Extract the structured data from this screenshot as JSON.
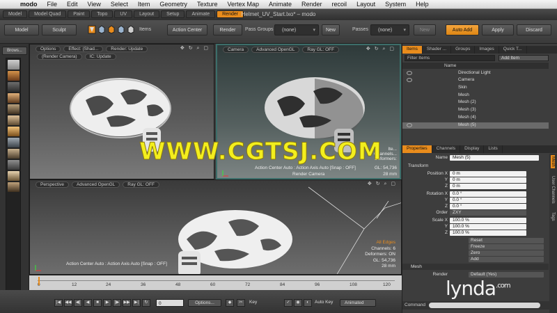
{
  "menubar": {
    "app": "modo",
    "items": [
      "File",
      "Edit",
      "View",
      "Select",
      "Item",
      "Geometry",
      "Texture",
      "Vertex Map",
      "Animate",
      "Render",
      "recoil",
      "Layout",
      "System",
      "Help"
    ]
  },
  "window": {
    "title": "Helmet_UV_Start.lxo* – modo",
    "layout_tabs": [
      "Model",
      "Model Quad",
      "Paint",
      "Topo",
      "UV",
      "Layout",
      "Setup",
      "Animate",
      "Render"
    ],
    "active_tab": "Render"
  },
  "toolbar": {
    "model": "Model",
    "sculpt": "Sculpt",
    "items": "Items",
    "action_center": "Action Center",
    "render": "Render",
    "pass_groups_label": "Pass Groups",
    "pass_groups_value": "(none)",
    "new": "New",
    "passes_label": "Passes",
    "passes_value": "(none)",
    "new2": "New",
    "auto_add": "Auto Add",
    "apply": "Apply",
    "discard": "Discard"
  },
  "sidebar": {
    "browse": "Brows..."
  },
  "viewports": {
    "topleft": {
      "chips": [
        "Options",
        "Effect: (Shad...",
        "Render: Update"
      ],
      "chips2": [
        "(Render Camera)",
        "IC: Update"
      ]
    },
    "topright": {
      "chips": [
        "Camera",
        "Advanced OpenGL",
        "Ray GL: OFF"
      ],
      "info": [
        "Ite...",
        "Channels...",
        "Deformers:"
      ],
      "footer_left": "Action Center Auto : Action Axis Auto  [Snap : OFF]",
      "gl": "GL: 54,736",
      "footer_center": "Render Camera",
      "mm": "28 mm"
    },
    "bottom": {
      "chips": [
        "Perspective",
        "Advanced OpenGL",
        "Ray GL: OFF"
      ],
      "info": [
        "All Edges",
        "Channels: 6",
        "Deformers: ON",
        "GL: 54,736",
        "28 mm"
      ],
      "footer": "Action Center Auto : Action Axis Auto  [Snap : OFF]"
    }
  },
  "items_panel": {
    "tabs": [
      "Items",
      "Shader ...",
      "Groups",
      "Images",
      "Quick T..."
    ],
    "active": "Items",
    "filter": "Filter Items",
    "add_item": "Add Item",
    "name_header": "Name",
    "rows": [
      {
        "name": "Directional Light",
        "selected": false
      },
      {
        "name": "Camera",
        "selected": false
      },
      {
        "name": "Skin",
        "selected": false
      },
      {
        "name": "Mesh",
        "selected": false
      },
      {
        "name": "Mesh (2)",
        "selected": false
      },
      {
        "name": "Mesh (3)",
        "selected": false
      },
      {
        "name": "Mesh (4)",
        "selected": false
      },
      {
        "name": "Mesh (5)",
        "selected": true
      }
    ]
  },
  "properties_panel": {
    "tabs": [
      "Properties",
      "Channels",
      "Display",
      "Lists"
    ],
    "active": "Properties",
    "side_tabs": [
      "Mesh",
      "User Channels",
      "Tags"
    ],
    "name_label": "Name",
    "name_value": "Mesh (5)",
    "transform_header": "Transform",
    "rows": [
      {
        "label": "Position X",
        "value": "0 m"
      },
      {
        "label": "Y",
        "value": "0 m"
      },
      {
        "label": "Z",
        "value": "0 m"
      },
      {
        "label": "Rotation X",
        "value": "0.0 °"
      },
      {
        "label": "Y",
        "value": "0.0 °"
      },
      {
        "label": "Z",
        "value": "0.0 °"
      },
      {
        "label": "Order",
        "value": "ZXY"
      },
      {
        "label": "Scale X",
        "value": "100.0 %"
      },
      {
        "label": "Y",
        "value": "100.0 %"
      },
      {
        "label": "Z",
        "value": "100.0 %"
      }
    ],
    "actions": [
      "Reset",
      "Freeze",
      "Zero",
      "Add"
    ],
    "mesh_header": "Mesh",
    "render_label": "Render",
    "render_value": "Default (Yes)",
    "command_label": "Command"
  },
  "timeline": {
    "ticks": [
      "0",
      "12",
      "24",
      "36",
      "48",
      "60",
      "72",
      "84",
      "96",
      "108",
      "120"
    ]
  },
  "transport": {
    "frame": "0",
    "options": "Options...",
    "key": "Key",
    "auto_key": "Auto Key",
    "animated": "Animated"
  },
  "overlay": {
    "watermark": "WWW.CGTSJ.COM",
    "lynda": "lynda",
    "lynda_suffix": ".com"
  },
  "colors": {
    "accent": "#e98c1c",
    "watermark": "#f3ee1d"
  }
}
